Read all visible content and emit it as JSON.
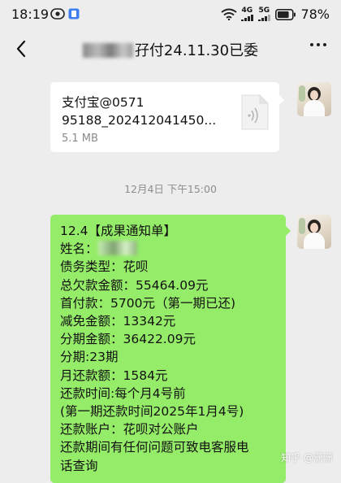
{
  "status_bar": {
    "time": "18:19",
    "network_4g": "4G",
    "network_5g": "5G",
    "battery": "78%"
  },
  "header": {
    "title_prefix": "",
    "title_suffix": "孖付24.11.30已委"
  },
  "messages": {
    "file": {
      "name_line1": "支付宝@0571",
      "name_line2": "95188_202412041450...",
      "size": "5.1 MB",
      "icon": "audio-file-icon"
    },
    "timestamp": "12月4日 下午15:00",
    "notice": {
      "lines": [
        "12.4【成果通知单】",
        "姓名：",
        "债务类型：花呗",
        "总欠款金额：55464.09元",
        "首付款：5700元（第一期已还)",
        "减免金额：13342元",
        "分期金额：36422.09元",
        "分期:23期",
        "月还款额：1584元",
        "还款时间:每个月4号前",
        "(第一期还款时间2025年1月4号)",
        "还款账户：花呗对公账户",
        "还款期间有任何问题可致电客服电",
        "话查询"
      ]
    }
  },
  "watermark": "知乎 @潇潇",
  "colors": {
    "background": "#ededed",
    "bubble_green": "#95ec69",
    "card_white": "#ffffff"
  }
}
